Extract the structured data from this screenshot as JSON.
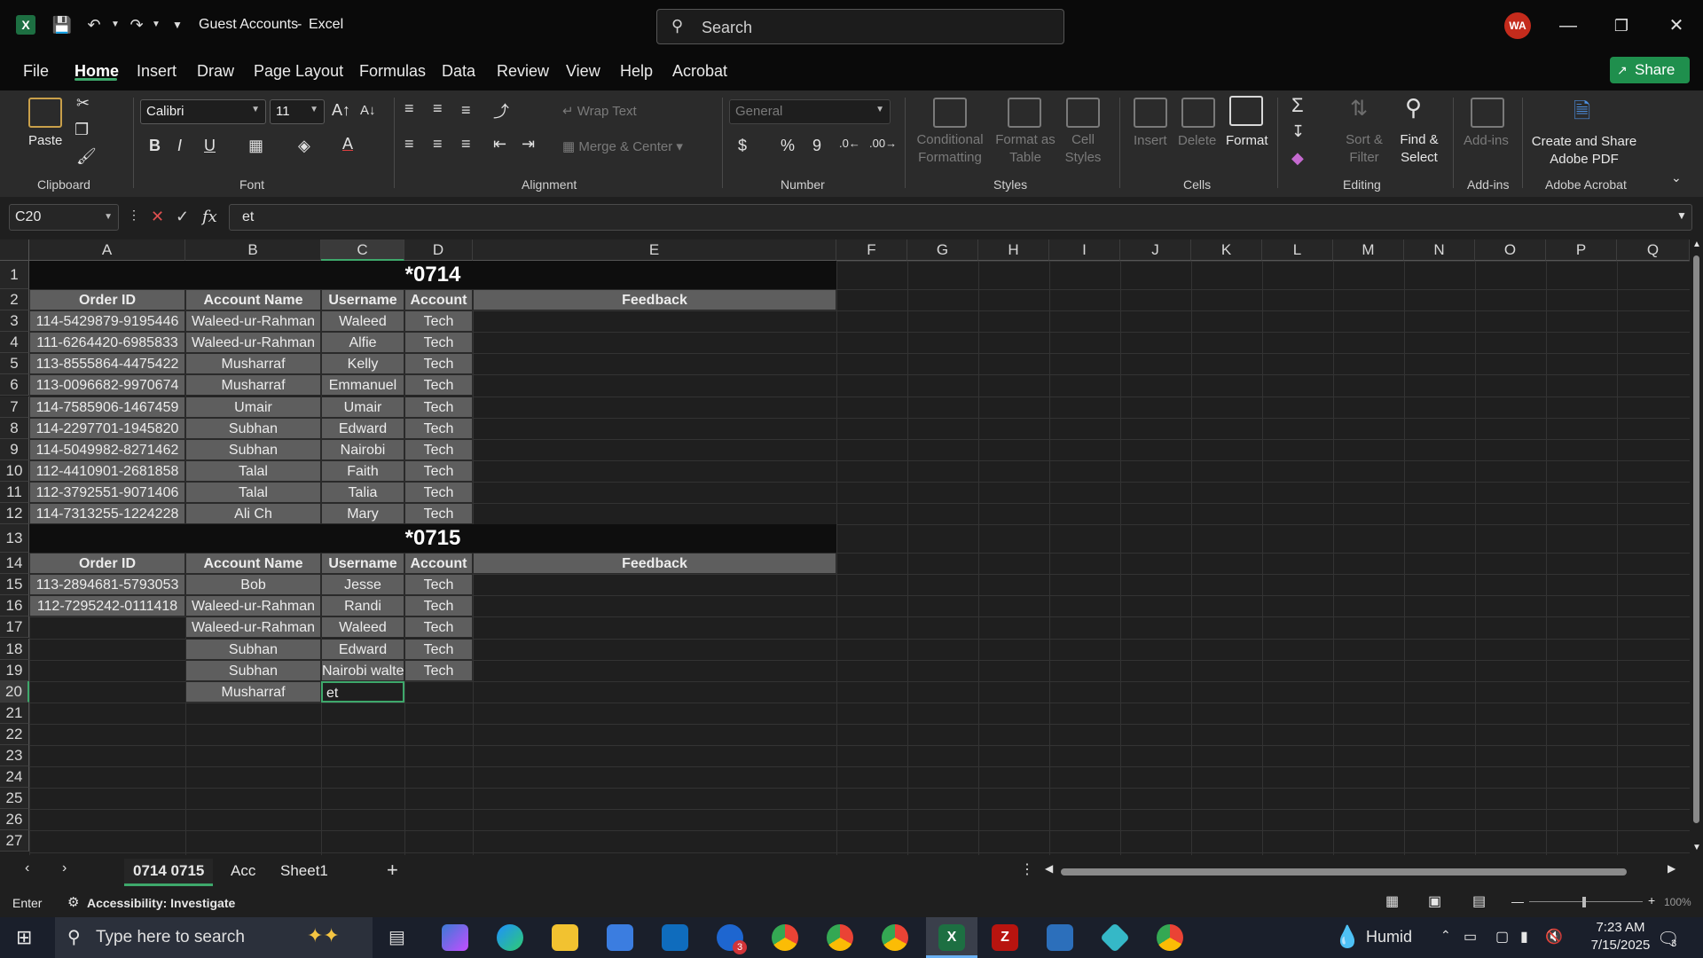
{
  "titlebar": {
    "doc_title": "Guest Accounts",
    "sep": "-",
    "app_name": "Excel",
    "search_placeholder": "Search",
    "avatar": "WA"
  },
  "menu": [
    "File",
    "Home",
    "Insert",
    "Draw",
    "Page Layout",
    "Formulas",
    "Data",
    "Review",
    "View",
    "Help",
    "Acrobat"
  ],
  "share_label": "Share",
  "ribbon": {
    "clipboard": {
      "paste": "Paste",
      "group": "Clipboard"
    },
    "font": {
      "name": "Calibri",
      "size": "11",
      "bold": "B",
      "italic": "I",
      "underline": "U",
      "group": "Font"
    },
    "alignment": {
      "wrap": "Wrap Text",
      "merge": "Merge & Center",
      "group": "Alignment"
    },
    "number": {
      "format": "General",
      "currency": "$",
      "percent": "%",
      "comma": "9",
      "group": "Number"
    },
    "styles": {
      "conditional": "Conditional",
      "conditional2": "Formatting",
      "format_as": "Format as",
      "table": "Table",
      "cell": "Cell",
      "styles": "Styles",
      "group": "Styles"
    },
    "cells": {
      "insert": "Insert",
      "delete": "Delete",
      "format": "Format",
      "group": "Cells"
    },
    "editing": {
      "sort": "Sort &",
      "filter": "Filter",
      "find": "Find &",
      "select": "Select",
      "group": "Editing"
    },
    "addins": {
      "label": "Add-ins",
      "group": "Add-ins"
    },
    "acrobat": {
      "line1": "Create and Share",
      "line2": "Adobe PDF",
      "group": "Adobe Acrobat"
    }
  },
  "formula_bar": {
    "name_box": "C20",
    "fx": "fx",
    "value": "et"
  },
  "columns": [
    "A",
    "B",
    "C",
    "D",
    "E",
    "F",
    "G",
    "H",
    "I",
    "J",
    "K",
    "L",
    "M",
    "N",
    "O",
    "P",
    "Q"
  ],
  "rows": [
    "1",
    "2",
    "3",
    "4",
    "5",
    "6",
    "7",
    "8",
    "9",
    "10",
    "11",
    "12",
    "13",
    "14",
    "15",
    "16",
    "17",
    "18",
    "19",
    "20",
    "21",
    "22",
    "23",
    "24",
    "25",
    "26",
    "27"
  ],
  "sheet": {
    "section1_title": "*0714",
    "section2_title": "*0715",
    "headers": {
      "order_id": "Order ID",
      "account_name": "Account Name",
      "username": "Username",
      "account": "Account",
      "feedback": "Feedback"
    },
    "section1_rows": [
      [
        "114-5429879-9195446",
        "Waleed-ur-Rahman",
        "Waleed",
        "Tech"
      ],
      [
        "111-6264420-6985833",
        "Waleed-ur-Rahman",
        "Alfie",
        "Tech"
      ],
      [
        "113-8555864-4475422",
        "Musharraf",
        "Kelly",
        "Tech"
      ],
      [
        "113-0096682-9970674",
        "Musharraf",
        "Emmanuel",
        "Tech"
      ],
      [
        "114-7585906-1467459",
        "Umair",
        "Umair",
        "Tech"
      ],
      [
        "114-2297701-1945820",
        "Subhan",
        "Edward",
        "Tech"
      ],
      [
        "114-5049982-8271462",
        "Subhan",
        "Nairobi",
        "Tech"
      ],
      [
        "112-4410901-2681858",
        "Talal",
        "Faith",
        "Tech"
      ],
      [
        "112-3792551-9071406",
        "Talal",
        "Talia",
        "Tech"
      ],
      [
        "114-7313255-1224228",
        "Ali Ch",
        "Mary",
        "Tech"
      ]
    ],
    "section2_rows": [
      [
        "113-2894681-5793053",
        "Bob",
        "Jesse",
        "Tech"
      ],
      [
        "112-7295242-0111418",
        "Waleed-ur-Rahman",
        "Randi",
        "Tech"
      ],
      [
        "",
        "Waleed-ur-Rahman",
        "Waleed",
        "Tech"
      ],
      [
        "",
        "Subhan",
        "Edward",
        "Tech"
      ],
      [
        "",
        "Subhan",
        "Nairobi walte",
        "Tech"
      ],
      [
        "",
        "Musharraf",
        "et",
        ""
      ]
    ]
  },
  "sheet_tabs": [
    "0714 0715",
    "Acc",
    "Sheet1"
  ],
  "status": {
    "mode": "Enter",
    "accessibility": "Accessibility: Investigate",
    "zoom": "100%"
  },
  "taskbar": {
    "search_placeholder": "Type here to search",
    "weather": "Humid",
    "time": "7:23 AM",
    "date": "7/15/2025",
    "notif_count": "3",
    "outlook_badge": "3"
  }
}
